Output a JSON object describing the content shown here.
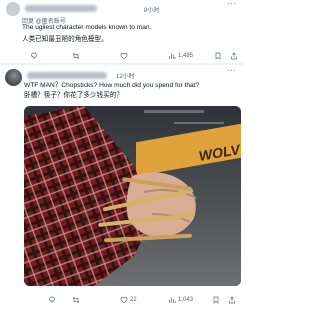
{
  "post1": {
    "time": "8小时",
    "reply_context": "回复 @匿名账号",
    "text_en": "The ugliest character models known to man.",
    "text_zh": "人类已知最丑陋的角色模型。",
    "views": "1,485"
  },
  "post2": {
    "time": "12小时",
    "text_en": "WTF MAN？Chopsticks? How much did you spend for that?",
    "text_zh": "卧槽？筷子？你花了多少钱买的？",
    "media_sign_text": "WOLV",
    "likes": "22",
    "views": "1,043"
  },
  "icons": [
    "more-icon",
    "reply-icon",
    "retweet-icon",
    "like-icon",
    "views-icon",
    "bookmark-icon",
    "share-icon"
  ],
  "colors": {
    "text": "#0f1419",
    "secondary": "#536471",
    "divider": "#eff3f4",
    "sign": "#e0a23a"
  }
}
